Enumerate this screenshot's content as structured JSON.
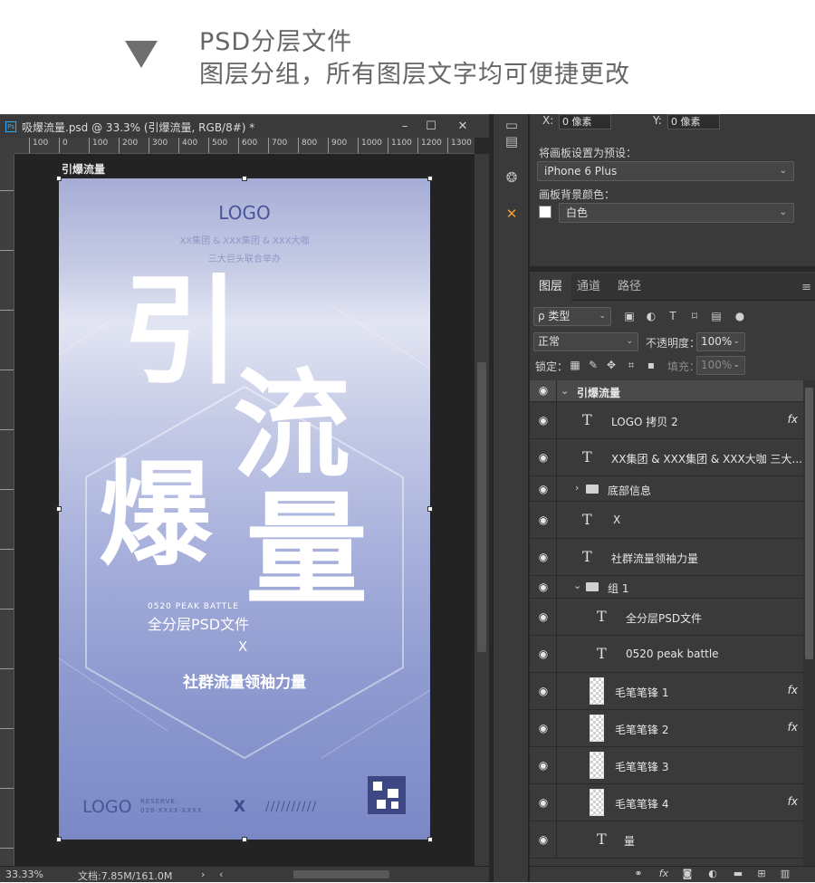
{
  "header": {
    "line1": "PSD分层文件",
    "line2": "图层分组，所有图层文字均可便捷更改"
  },
  "document": {
    "title": "吸爆流量.psd @ 33.3% (引爆流量, RGB/8#) *",
    "ps_badge": "Ps",
    "window_buttons": [
      "–",
      "☐",
      "✕"
    ],
    "ruler_marks": [
      "100",
      "0",
      "100",
      "200",
      "300",
      "400",
      "500",
      "600",
      "700",
      "800",
      "900",
      "1000",
      "1100",
      "1200",
      "1300"
    ],
    "artboard_label": "引爆流量",
    "zoom": "33.33%",
    "doc_size": "文档:7.85M/161.0M"
  },
  "artboard": {
    "logo": "LOGO",
    "sub1": "XX集团 & XXX集团 & XXX大咖",
    "sub2": "三大巨头联合举办",
    "brush_chars": [
      "引",
      "流",
      "爆",
      "量"
    ],
    "peak": "0520 PEAK BATTLE",
    "all_psd": "全分层PSD文件",
    "x_mark": "X",
    "lead_line": "社群流量领袖力量",
    "footer_logo": "LOGO",
    "reserve_line1": "RESERVE:",
    "reserve_line2": "028-XXXX-XXXX",
    "footer_x": "X",
    "slashes": "//////////"
  },
  "properties": {
    "x_label": "X:",
    "x_value": "0 像素",
    "y_label": "Y:",
    "y_value": "0 像素",
    "preset_label": "将画板设置为预设：",
    "preset_value": "iPhone 6 Plus",
    "bg_label": "画板背景颜色：",
    "bg_value": "白色"
  },
  "layers_panel": {
    "tabs": [
      "图层",
      "通道",
      "路径"
    ],
    "kind_filter": "ρ 类型",
    "blend_mode": "正常",
    "opacity_label": "不透明度：",
    "opacity_value": "100%",
    "lock_label": "锁定：",
    "fill_label": "填充：",
    "fill_value": "100%",
    "layers": [
      {
        "name": "引爆流量",
        "kind": "artboard",
        "fx": ""
      },
      {
        "name": "LOGO 拷贝 2",
        "kind": "text",
        "fx": "fx"
      },
      {
        "name": "XX集团 & XXX集团 & XXX大咖 三大...",
        "kind": "text",
        "fx": ""
      },
      {
        "name": "底部信息",
        "kind": "group",
        "fx": ""
      },
      {
        "name": "X",
        "kind": "text",
        "fx": ""
      },
      {
        "name": "社群流量领袖力量",
        "kind": "text",
        "fx": ""
      },
      {
        "name": "组 1",
        "kind": "group-open",
        "fx": ""
      },
      {
        "name": "全分层PSD文件",
        "kind": "text",
        "fx": ""
      },
      {
        "name": "0520 peak battle",
        "kind": "text",
        "fx": ""
      },
      {
        "name": "毛笔笔锋 1",
        "kind": "pixel",
        "fx": "fx"
      },
      {
        "name": "毛笔笔锋 2",
        "kind": "pixel",
        "fx": "fx"
      },
      {
        "name": "毛笔笔锋 3",
        "kind": "pixel",
        "fx": ""
      },
      {
        "name": "毛笔笔锋 4",
        "kind": "pixel",
        "fx": "fx"
      },
      {
        "name": "量",
        "kind": "text",
        "fx": ""
      }
    ],
    "footer_icons": [
      "link-icon",
      "fx-icon",
      "mask-icon",
      "adjustment-icon",
      "folder-icon",
      "new-layer-icon",
      "trash-icon"
    ],
    "footer_fx": "fx"
  },
  "colors": {
    "ps_bg": "#282828",
    "panel_bg": "#3a3a3a",
    "artboard_text": "#4a5597"
  }
}
